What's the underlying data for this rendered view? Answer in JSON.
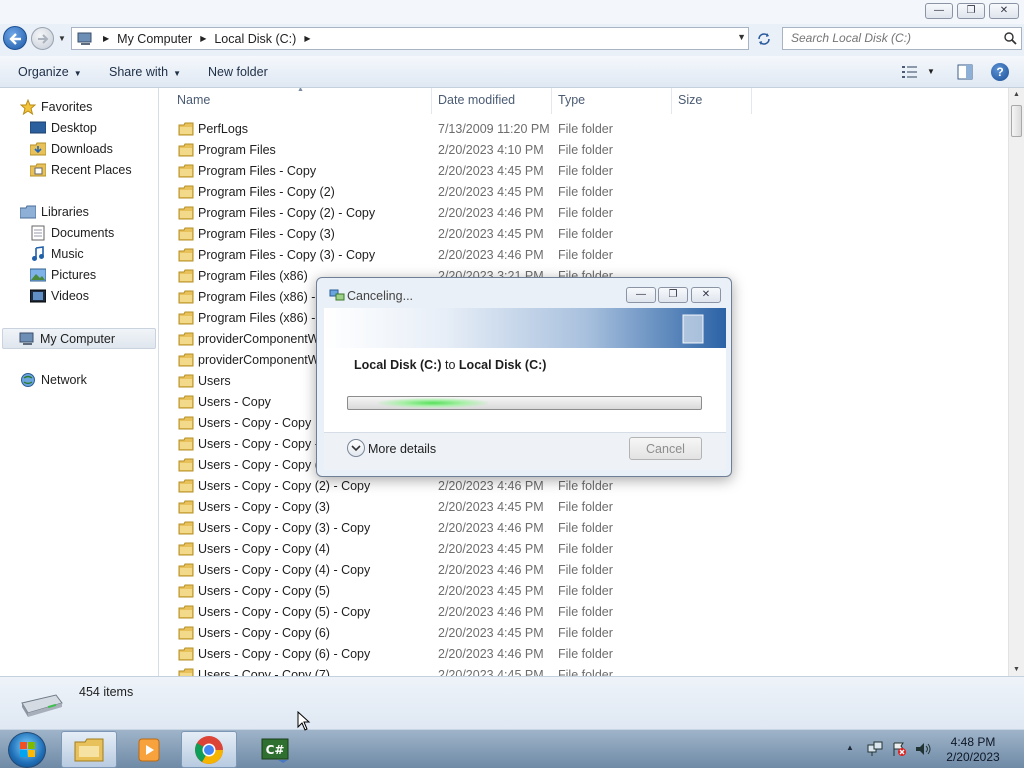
{
  "window": {
    "minimize_glyph": "—",
    "maximize_glyph": "❐",
    "close_glyph": "✕"
  },
  "address": {
    "crumbs": [
      "My Computer",
      "Local Disk (C:)"
    ],
    "search_placeholder": "Search Local Disk (C:)"
  },
  "toolbar": {
    "organize": "Organize",
    "share_with": "Share with",
    "new_folder": "New folder"
  },
  "nav": {
    "favorites": "Favorites",
    "desktop": "Desktop",
    "downloads": "Downloads",
    "recent_places": "Recent Places",
    "libraries": "Libraries",
    "documents": "Documents",
    "music": "Music",
    "pictures": "Pictures",
    "videos": "Videos",
    "my_computer": "My Computer",
    "network": "Network"
  },
  "columns": {
    "name": "Name",
    "date_modified": "Date modified",
    "type": "Type",
    "size": "Size"
  },
  "files": [
    {
      "name": "PerfLogs",
      "date": "7/13/2009 11:20 PM",
      "type": "File folder"
    },
    {
      "name": "Program Files",
      "date": "2/20/2023 4:10 PM",
      "type": "File folder"
    },
    {
      "name": "Program Files - Copy",
      "date": "2/20/2023 4:45 PM",
      "type": "File folder"
    },
    {
      "name": "Program Files - Copy (2)",
      "date": "2/20/2023 4:45 PM",
      "type": "File folder"
    },
    {
      "name": "Program Files - Copy (2) - Copy",
      "date": "2/20/2023 4:46 PM",
      "type": "File folder"
    },
    {
      "name": "Program Files - Copy (3)",
      "date": "2/20/2023 4:45 PM",
      "type": "File folder"
    },
    {
      "name": "Program Files - Copy (3) - Copy",
      "date": "2/20/2023 4:46 PM",
      "type": "File folder"
    },
    {
      "name": "Program Files (x86)",
      "date": "2/20/2023 3:21 PM",
      "type": "File folder"
    },
    {
      "name": "Program Files (x86) - C",
      "date": "",
      "type": ""
    },
    {
      "name": "Program Files (x86) - C",
      "date": "",
      "type": ""
    },
    {
      "name": "providerComponentW",
      "date": "",
      "type": ""
    },
    {
      "name": "providerComponentW",
      "date": "",
      "type": ""
    },
    {
      "name": "Users",
      "date": "",
      "type": ""
    },
    {
      "name": "Users - Copy",
      "date": "",
      "type": ""
    },
    {
      "name": "Users - Copy - Copy",
      "date": "",
      "type": ""
    },
    {
      "name": "Users - Copy - Copy -",
      "date": "",
      "type": ""
    },
    {
      "name": "Users - Copy - Copy (2",
      "date": "",
      "type": ""
    },
    {
      "name": "Users - Copy - Copy (2) - Copy",
      "date": "2/20/2023 4:46 PM",
      "type": "File folder"
    },
    {
      "name": "Users - Copy - Copy (3)",
      "date": "2/20/2023 4:45 PM",
      "type": "File folder"
    },
    {
      "name": "Users - Copy - Copy (3) - Copy",
      "date": "2/20/2023 4:46 PM",
      "type": "File folder"
    },
    {
      "name": "Users - Copy - Copy (4)",
      "date": "2/20/2023 4:45 PM",
      "type": "File folder"
    },
    {
      "name": "Users - Copy - Copy (4) - Copy",
      "date": "2/20/2023 4:46 PM",
      "type": "File folder"
    },
    {
      "name": "Users - Copy - Copy (5)",
      "date": "2/20/2023 4:45 PM",
      "type": "File folder"
    },
    {
      "name": "Users - Copy - Copy (5) - Copy",
      "date": "2/20/2023 4:46 PM",
      "type": "File folder"
    },
    {
      "name": "Users - Copy - Copy (6)",
      "date": "2/20/2023 4:45 PM",
      "type": "File folder"
    },
    {
      "name": "Users - Copy - Copy (6) - Copy",
      "date": "2/20/2023 4:46 PM",
      "type": "File folder"
    },
    {
      "name": "Users - Copy - Copy (7)",
      "date": "2/20/2023 4:45 PM",
      "type": "File folder"
    }
  ],
  "status": {
    "item_count": "454 items"
  },
  "dialog": {
    "title": "Canceling...",
    "source": "Local Disk (C:)",
    "to_word": "to",
    "destination": "Local Disk (C:)",
    "more_details": "More details",
    "cancel": "Cancel"
  },
  "taskbar": {
    "time": "4:48 PM",
    "date": "2/20/2023",
    "apps": [
      "windows-explorer",
      "media-player",
      "chrome",
      "csharp-app"
    ]
  },
  "colors": {
    "accent": "#1f6fb8",
    "progress_green": "#57e05a",
    "taskbar": "#8aa3bd"
  }
}
